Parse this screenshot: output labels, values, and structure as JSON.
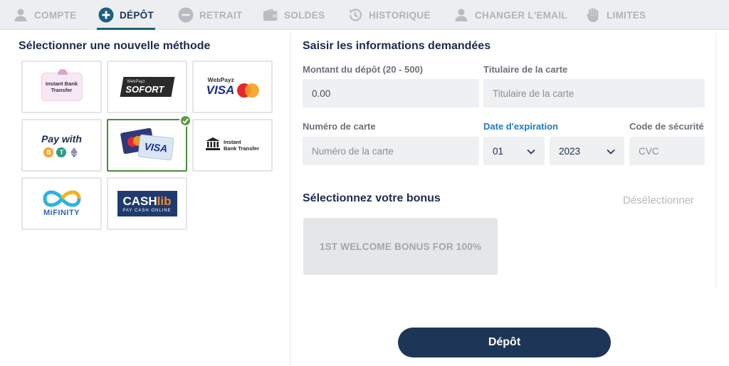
{
  "tabs": [
    {
      "label": "COMPTE",
      "icon": "user-icon",
      "active": false
    },
    {
      "label": "DÉPÔT",
      "icon": "plus-circle-icon",
      "active": true
    },
    {
      "label": "RETRAIT",
      "icon": "minus-circle-icon",
      "active": false
    },
    {
      "label": "SOLDES",
      "icon": "wallet-icon",
      "active": false
    },
    {
      "label": "HISTORIQUE",
      "icon": "history-icon",
      "active": false
    },
    {
      "label": "CHANGER L'EMAIL",
      "icon": "user-icon",
      "active": false
    },
    {
      "label": "LIMITES",
      "icon": "hand-icon",
      "active": false
    }
  ],
  "left": {
    "title": "Sélectionner une nouvelle méthode",
    "methods": [
      {
        "name": "instant-bank-transfer-pink",
        "lines": [
          "Instant Bank",
          "Transfer"
        ]
      },
      {
        "name": "sofort",
        "brand_small": "WebPayz",
        "brand": "SOFORT"
      },
      {
        "name": "webpayz-visa-mastercard",
        "brand_small": "WebPayz",
        "brand": "VISA",
        "mc": "mastercard"
      },
      {
        "name": "pay-with-crypto",
        "brand": "Pay with"
      },
      {
        "name": "visa-mastercard-cards",
        "brand": "VISA",
        "selected": true
      },
      {
        "name": "instant-bank-transfer",
        "lines": [
          "Instant",
          "Bank Transfer"
        ]
      },
      {
        "name": "mifinity",
        "brand": "MiFINITY"
      },
      {
        "name": "cashlib",
        "brand": "CASH",
        "brand2": "lib",
        "tagline": "PAY CASH ONLINE"
      }
    ]
  },
  "right": {
    "title": "Saisir les informations demandées",
    "amount_label": "Montant du dépôt (20 - 500)",
    "amount_value": "0.00",
    "holder_label": "Titulaire de la carte",
    "holder_placeholder": "Titulaire de la carte",
    "card_label": "Numéro de carte",
    "card_placeholder": "Numéro de la carte",
    "expiry_label": "Date d'expiration",
    "expiry_month": "01",
    "expiry_year": "2023",
    "cvc_label": "Code de sécurité",
    "cvc_placeholder": "CVC",
    "bonus_title": "Sélectionnez votre bonus",
    "deselect_label": "Désélectionner",
    "bonus_option": "1ST WELCOME BONUS FOR 100%",
    "submit_label": "Dépôt"
  },
  "colors": {
    "accent": "#1d3557",
    "tab_inactive": "#b0b4b8",
    "field_bg": "#eef0f1",
    "selected_border": "#4f8a3b",
    "link_blue": "#1a7bc6"
  }
}
